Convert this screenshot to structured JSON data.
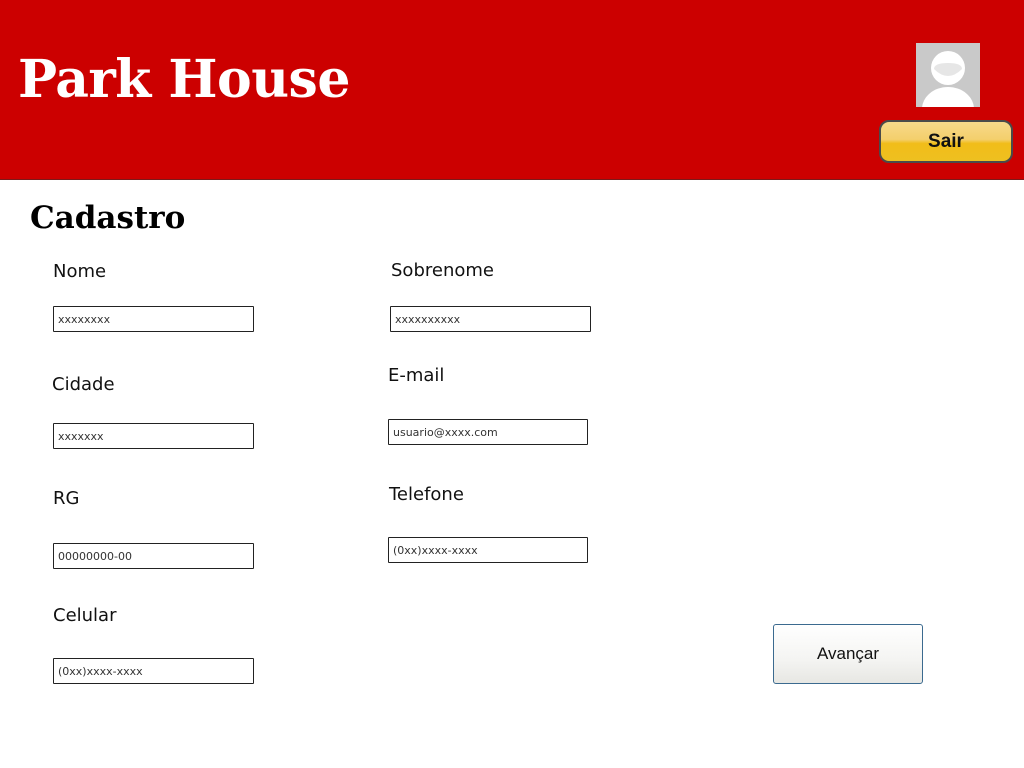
{
  "header": {
    "app_title": "Park House",
    "logout_label": "Sair",
    "brand_color": "#cc0000",
    "avatar_icon": "user-avatar-icon"
  },
  "form": {
    "title": "Cadastro",
    "fields": {
      "nome": {
        "label": "Nome",
        "value": "xxxxxxxx"
      },
      "sobrenome": {
        "label": "Sobrenome",
        "value": "xxxxxxxxxx"
      },
      "cidade": {
        "label": "Cidade",
        "value": "xxxxxxx"
      },
      "email": {
        "label": "E-mail",
        "value": "usuario@xxxx.com"
      },
      "rg": {
        "label": "RG",
        "value": "00000000-00"
      },
      "telefone": {
        "label": "Telefone",
        "value": "(0xx)xxxx-xxxx"
      },
      "celular": {
        "label": "Celular",
        "value": "(0xx)xxxx-xxxx"
      }
    },
    "next_label": "Avançar"
  }
}
